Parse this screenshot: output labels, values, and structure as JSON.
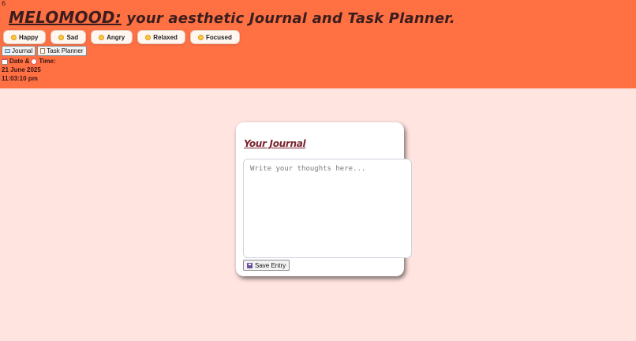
{
  "header": {
    "corner_glyph": "6",
    "brand": "MELOMOOD:",
    "tagline": " your aesthetic Journal and Task Planner.",
    "bg_color": "#ff7043"
  },
  "moods": [
    {
      "label": "Happy",
      "icon": "happy-emoji-icon"
    },
    {
      "label": "Sad",
      "icon": "sad-emoji-icon"
    },
    {
      "label": "Angry",
      "icon": "angry-emoji-icon"
    },
    {
      "label": "Relaxed",
      "icon": "relaxed-emoji-icon"
    },
    {
      "label": "Focused",
      "icon": "focused-emoji-icon"
    }
  ],
  "nav": {
    "journal_label": "Journal",
    "task_planner_label": "Task Planner"
  },
  "datetime": {
    "date_word": "Date &",
    "time_word": "Time:",
    "date": "21 June 2025",
    "time": "11:03:10 pm"
  },
  "journal": {
    "title": "Your Journal",
    "placeholder": "Write your thoughts here...",
    "value": "",
    "save_label": "Save Entry"
  },
  "colors": {
    "page_bg": "#ffe4df",
    "title_color": "#7a2431"
  }
}
